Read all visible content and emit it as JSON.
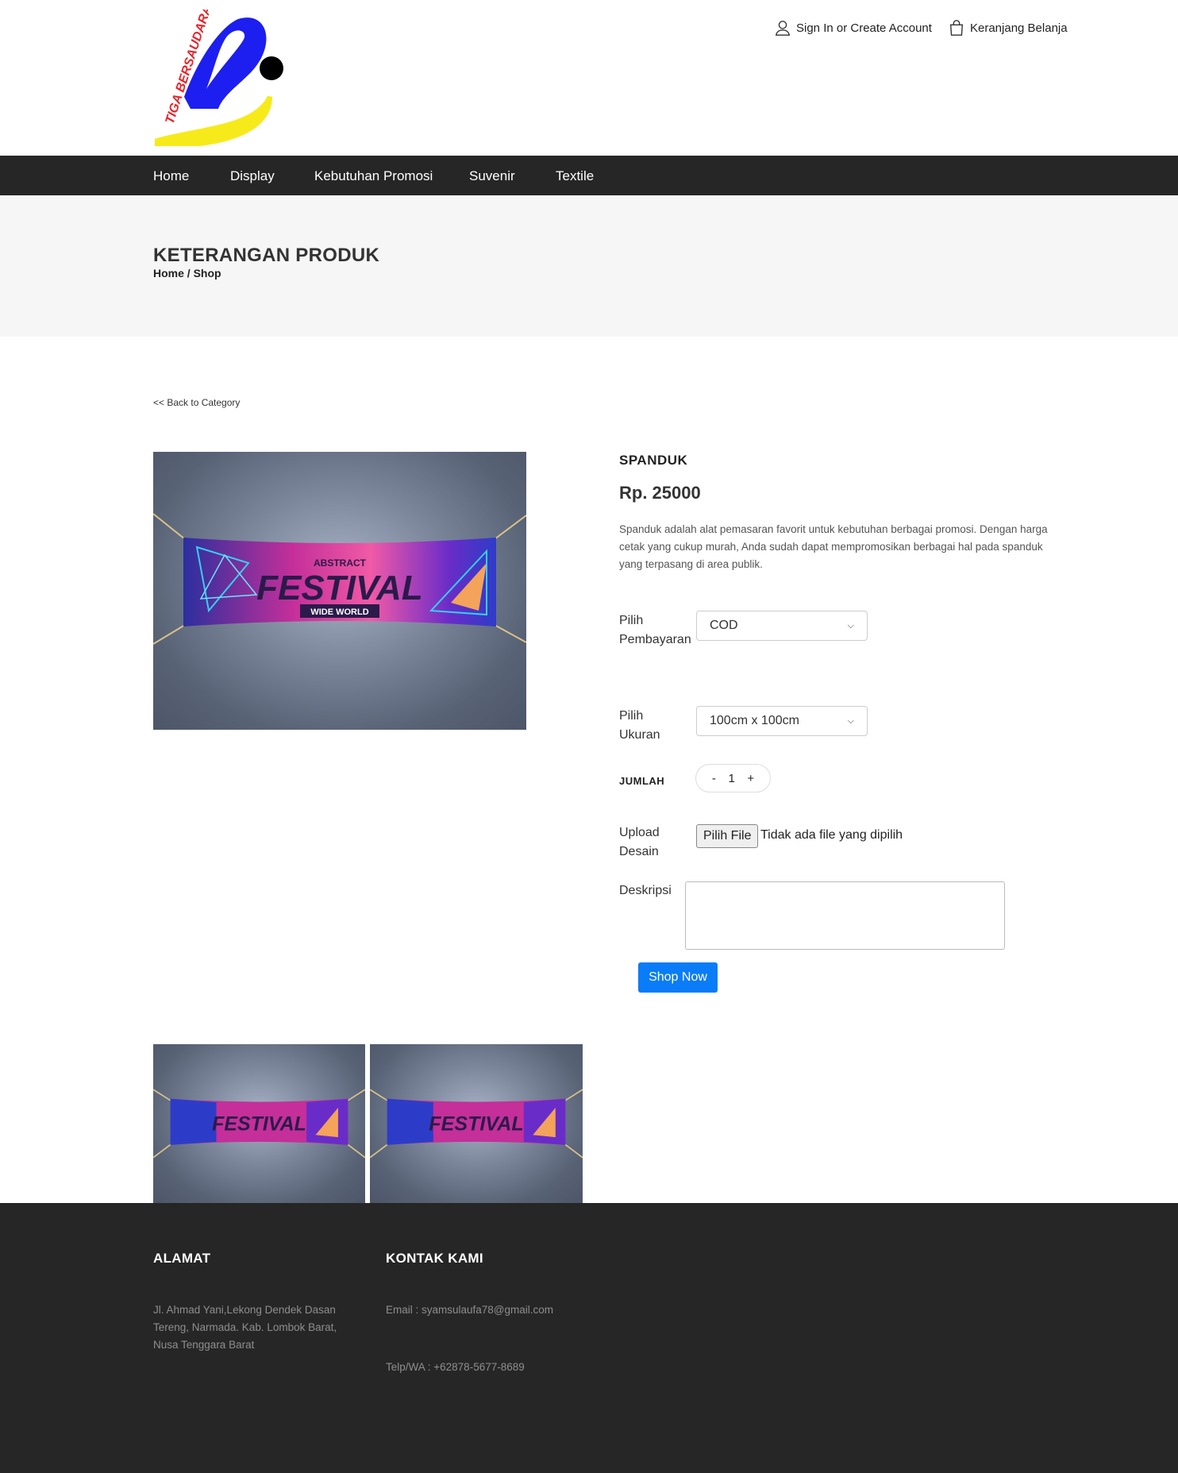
{
  "header": {
    "sign_in_label": "Sign In or Create Account",
    "cart_label": "Keranjang Belanja"
  },
  "logo": {
    "text": "TIGA BERSAUDARA",
    "colors": {
      "blue": "#1d1ff0",
      "yellow": "#f7ea1a",
      "red": "#e8232a",
      "black": "#000000"
    }
  },
  "nav": {
    "items": [
      "Home",
      "Display",
      "Kebutuhan Promosi",
      "Suvenir",
      "Textile"
    ]
  },
  "hero": {
    "title": "KETERANGAN PRODUK",
    "breadcrumb_home": "Home",
    "breadcrumb_sep": "/",
    "breadcrumb_shop": "Shop"
  },
  "back_link": "<< Back to Category",
  "banner_art": {
    "line1": "ABSTRACT",
    "line2": "FESTIVAL",
    "line3": "WIDE WORLD"
  },
  "product": {
    "name": "SPANDUK",
    "price": "Rp. 25000",
    "description": "Spanduk adalah alat pemasaran favorit untuk kebutuhan berbagai promosi. Dengan harga cetak yang cukup murah, Anda sudah dapat mempromosikan berbagai hal pada spanduk yang terpasang di area publik."
  },
  "form": {
    "payment_label_1": "Pilih",
    "payment_label_2": "Pembayaran",
    "payment_value": "COD",
    "size_label_1": "Pilih",
    "size_label_2": "Ukuran",
    "size_value": "100cm x 100cm",
    "qty_label": "JUMLAH",
    "qty_minus": "-",
    "qty_value": "1",
    "qty_plus": "+",
    "upload_label_1": "Upload",
    "upload_label_2": "Desain",
    "upload_button": "Pilih File",
    "upload_status": "Tidak ada file yang dipilih",
    "desc_label": "Deskripsi",
    "submit_label": "Shop Now",
    "submit_color": "#0a7cf7"
  },
  "footer": {
    "address_title": "ALAMAT",
    "address_text": "Jl. Ahmad Yani,Lekong Dendek Dasan Tereng, Narmada. Kab. Lombok Barat, Nusa Tenggara Barat",
    "contact_title": "KONTAK KAMI",
    "email": "Email : syamsulaufa78@gmail.com",
    "phone": "Telp/WA : +62878-5677-8689"
  }
}
